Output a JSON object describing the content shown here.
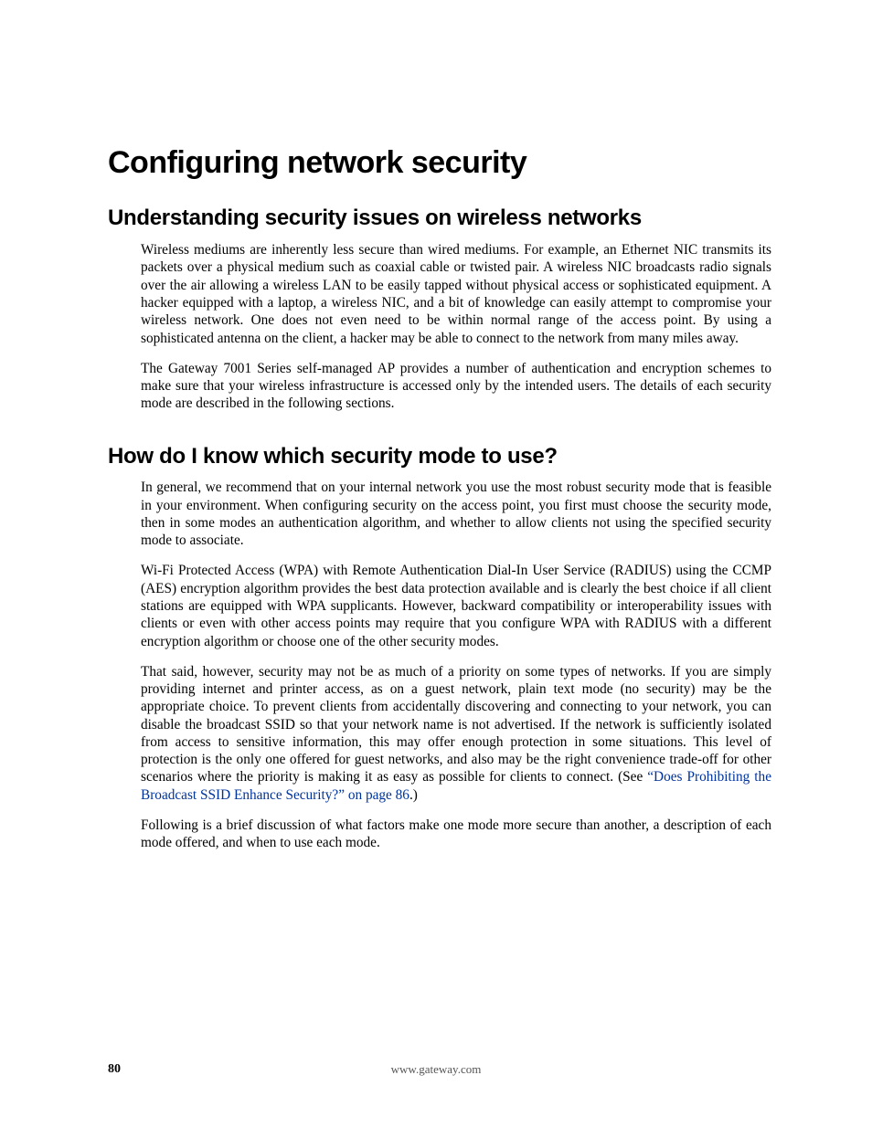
{
  "title": "Configuring network security",
  "sections": [
    {
      "heading": "Understanding security issues on wireless networks",
      "paragraphs": [
        "Wireless mediums are inherently less secure than wired mediums. For example, an Ethernet NIC transmits its packets over a physical medium such as coaxial cable or twisted pair. A wireless NIC broadcasts radio signals over the air allowing a wireless LAN to be easily tapped without physical access or sophisticated equipment. A hacker equipped with a laptop, a wireless NIC, and a bit of knowledge can easily attempt to compromise your wireless network. One does not even need to be within normal range of the access point. By using a sophisticated antenna on the client, a hacker may be able to connect to the network from many miles away.",
        "The Gateway 7001 Series self-managed AP provides a number of authentication and encryption schemes to make sure that your wireless infrastructure is accessed only by the intended users. The details of each security mode are described in the following sections."
      ]
    },
    {
      "heading": "How do I know which security mode to use?",
      "paragraphs": [
        "In general, we recommend that on your internal network you use the most robust security mode that is feasible in your environment. When configuring security on the access point, you first must choose the security mode, then in some modes an authentication algorithm, and whether to allow clients not using the specified security mode to associate.",
        "Wi-Fi Protected Access (WPA) with Remote Authentication Dial-In User Service (RADIUS) using the CCMP (AES) encryption algorithm provides the best data protection available and is clearly the best choice if all client stations are equipped with WPA supplicants. However, backward compatibility or interoperability issues with clients or even with other access points may require that you configure WPA with RADIUS with a different encryption algorithm or choose one of the other security modes."
      ],
      "xref_paragraph": {
        "pre": "That said, however, security may not be as much of a priority on some types of networks. If you are simply providing internet and printer access, as on a guest network, plain text mode (no security) may be the appropriate choice. To prevent clients from accidentally discovering and connecting to your network, you can disable the broadcast SSID so that your network name is not advertised. If the network is sufficiently isolated from access to sensitive information, this may offer enough protection in some situations. This level of protection is the only one offered for guest networks, and also may be the right convenience trade-off for other scenarios where the priority is making it as easy as possible for clients to connect. (See ",
        "link": "“Does Prohibiting the Broadcast SSID Enhance Security?” on page 86",
        "post": ".)"
      },
      "trailing_paragraphs": [
        "Following is a brief discussion of what factors make one mode more secure than another, a description of each mode offered, and when to use each mode."
      ]
    }
  ],
  "footer": {
    "page_number": "80",
    "url": "www.gateway.com"
  }
}
